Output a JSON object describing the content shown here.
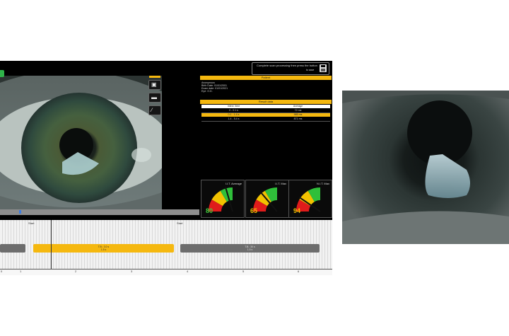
{
  "save_message": {
    "line1": "Complete scan processing then press the button",
    "line2": "to save"
  },
  "tools": {
    "camera_icon": "camera-icon",
    "car_icon": "car-icon",
    "tools_icon": "wrench-icon"
  },
  "patient": {
    "header": "Patient",
    "lines": [
      "Anonymous",
      "Birth Date: 01/01/2001",
      "Exam date: 01/01/2021",
      "Eye: O.D."
    ]
  },
  "results": {
    "header": "Result data",
    "columns": [
      "Interv. time",
      "Average"
    ],
    "rows": [
      [
        "0 - 0.1 s",
        "72 ms"
      ],
      [
        "0.1 - 1.4 s",
        "985 ms"
      ],
      [
        "1.4 - 5.4 s",
        "871 ms"
      ]
    ]
  },
  "gauges": [
    {
      "label": "I.I.T. Average",
      "value": "80",
      "color": "#3fcf3f",
      "needle_fraction": 0.82
    },
    {
      "label": "I.I.T. Max",
      "value": "65",
      "color": "#f2c200",
      "needle_fraction": 0.55
    },
    {
      "label": "N.I.T. Max",
      "value": "94",
      "color": "#f2c200",
      "needle_fraction": 0.38
    }
  ],
  "timeline": {
    "segments": [
      {
        "label": "",
        "color": "#6d6d6d"
      },
      {
        "label": "T.B.: 3.0 s",
        "sublabel": "1.5 s",
        "color": "#f5b80f"
      },
      {
        "label": "T.B.: 30 s",
        "sublabel": "1.5 s",
        "color": "#6d6d6d"
      }
    ],
    "ticks": [
      "0",
      "1",
      "2",
      "3",
      "4",
      "5",
      "6",
      "7"
    ],
    "markers": [
      "Start",
      "Start"
    ]
  }
}
